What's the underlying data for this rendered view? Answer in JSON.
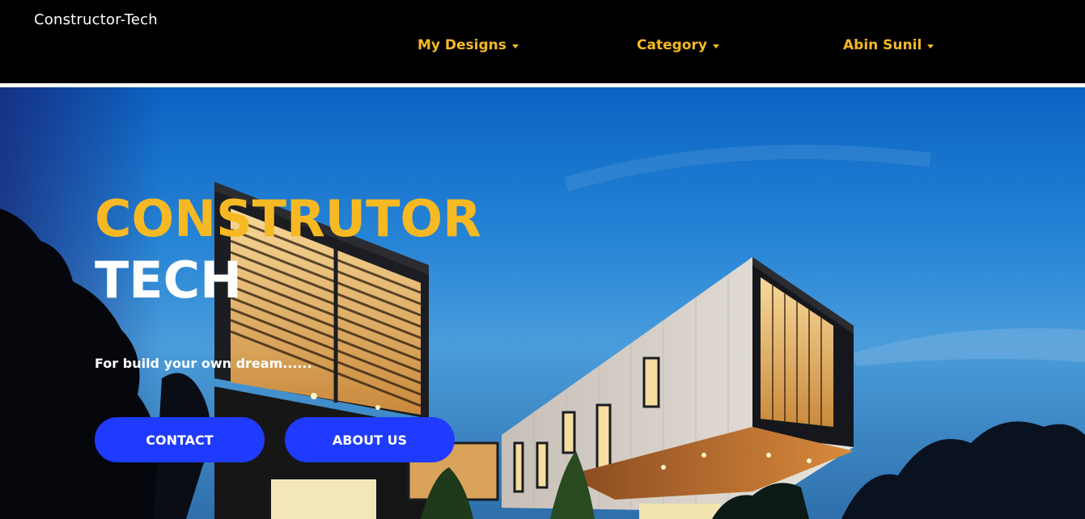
{
  "navbar": {
    "brand": "Constructor-Tech",
    "items": [
      {
        "label": "My Designs"
      },
      {
        "label": "Category"
      },
      {
        "label": "Abin Sunil"
      }
    ]
  },
  "hero": {
    "title_line1": "CONSTRUTOR",
    "title_line2": "TECH",
    "tagline": "For build your own dream......",
    "buttons": {
      "contact": "CONTACT",
      "about": "ABOUT US"
    }
  },
  "colors": {
    "accent": "#f6b923",
    "button": "#1f3bff",
    "navbar_bg": "#000000"
  }
}
